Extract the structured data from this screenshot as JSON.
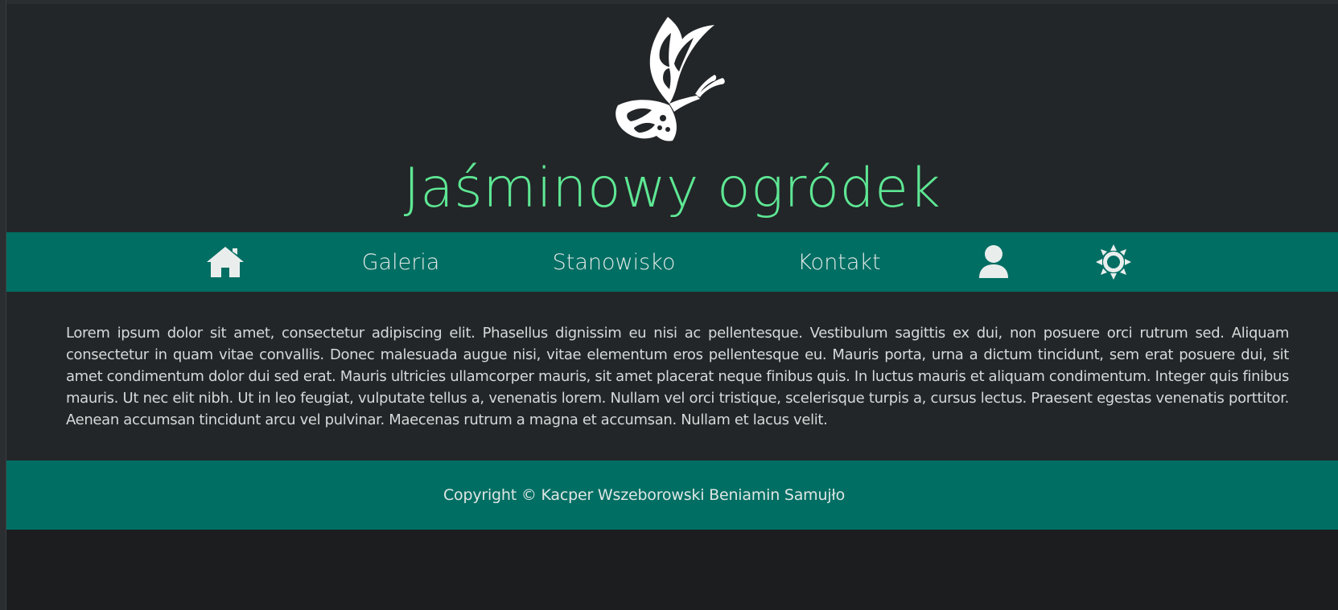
{
  "header": {
    "logo_icon": "butterfly-icon",
    "title": "Jaśminowy ogródek",
    "title_color": "#5ee794"
  },
  "nav": {
    "background": "#006e63",
    "items": [
      {
        "icon": "home-icon",
        "label": ""
      },
      {
        "label": "Galeria"
      },
      {
        "label": "Stanowisko"
      },
      {
        "label": "Kontakt"
      },
      {
        "icon": "user-icon",
        "label": ""
      },
      {
        "icon": "sun-icon",
        "label": ""
      }
    ]
  },
  "main": {
    "paragraph": "Lorem ipsum dolor sit amet, consectetur adipiscing elit. Phasellus dignissim eu nisi ac pellentesque. Vestibulum sagittis ex dui, non posuere orci rutrum sed. Aliquam consectetur in quam vitae convallis. Donec malesuada augue nisi, vitae elementum eros pellentesque eu. Mauris porta, urna a dictum tincidunt, sem erat posuere dui, sit amet condimentum dolor dui sed erat. Mauris ultricies ullamcorper mauris, sit amet placerat neque finibus quis. In luctus mauris et aliquam condimentum. Integer quis finibus mauris. Ut nec elit nibh. Ut in leo feugiat, vulputate tellus a, venenatis lorem. Nullam vel orci tristique, scelerisque turpis a, cursus lectus. Praesent egestas venenatis porttitor. Aenean accumsan tincidunt arcu vel pulvinar. Maecenas rutrum a magna et accumsan. Nullam et lacus velit."
  },
  "footer": {
    "copyright": "Copyright © Kacper Wszeborowski Beniamin Samujło"
  },
  "colors": {
    "page_bg": "#222628",
    "outer_bg": "#1b1d1f",
    "accent": "#006e63"
  }
}
